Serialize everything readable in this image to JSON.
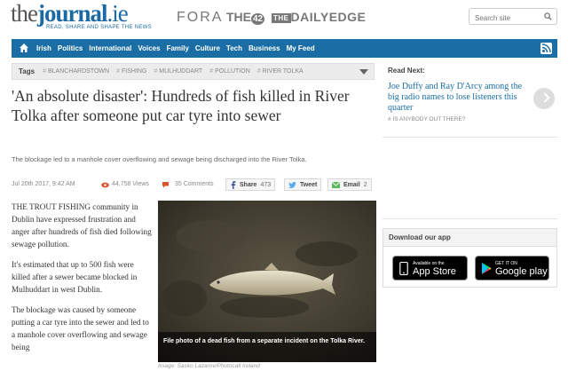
{
  "header": {
    "logo_the": "the",
    "logo_journal": "journal",
    "logo_ie": ".ie",
    "logo_tagline": "READ, SHARE AND SHAPE THE NEWS",
    "partners": {
      "fora": "FORA",
      "the42_the": "THE",
      "the42_num": "42",
      "daily_the": "THE",
      "daily": "DAILYEDGE"
    },
    "search_placeholder": "Search site",
    "search_icon": "search-icon"
  },
  "nav": {
    "home_icon": "home-icon",
    "items": [
      "Irish",
      "Politics",
      "International",
      "Voices",
      "Family",
      "Culture",
      "Tech",
      "Business",
      "My Feed"
    ],
    "rss_icon": "rss-icon"
  },
  "tags": {
    "label": "Tags",
    "items": [
      "BLANCHARDSTOWN",
      "FISHING",
      "MULHUDDART",
      "POLLUTION",
      "RIVER TOLKA"
    ],
    "hash": "#"
  },
  "article": {
    "headline": "'An absolute disaster': Hundreds of fish killed in River Tolka after someone put car tyre into sewer",
    "standfirst": "The blockage led to a manhole cover overflowing and sewage being discharged into the River Tolka.",
    "date": "Jul 20th 2017, 9:42 AM",
    "views": "44,758 Views",
    "comments": "35 Comments",
    "share": {
      "label": "Share",
      "count": "473"
    },
    "tweet": {
      "label": "Tweet"
    },
    "email": {
      "label": "Email",
      "count": "2"
    },
    "p1_caps": "The trout fishing",
    "p1_rest": " community in Dublin have expressed frustration and anger after hundreds of fish died following sewage pollution.",
    "p2": "It's estimated that up to 500 fish were killed after a sewer became blocked in Mulhuddart in west Dublin.",
    "p3": "The blockage was caused by someone putting a car tyre into the sewer and led to a manhole cover overflowing and sewage being",
    "photo_caption": "File photo of a dead fish from a separate incident on the Tolka River.",
    "photo_credit": "Image: Sasko Lazarov/Photocall Ireland"
  },
  "sidebar": {
    "read_next_title": "Read Next:",
    "read_next_link": "Joe Duffy and Ray D'Arcy among the big radio names to lose listeners this quarter",
    "read_next_tag": "# IS ANYBODY OUT THERE?",
    "app_title": "Download our app",
    "apple_small": "Available on the",
    "apple_big": "App Store",
    "google_small": "GET IT ON",
    "google_big": "Google play"
  },
  "colors": {
    "brand_blue": "#1a6ea5",
    "link_blue": "#1a6ea5",
    "views_red": "#d9532c"
  }
}
